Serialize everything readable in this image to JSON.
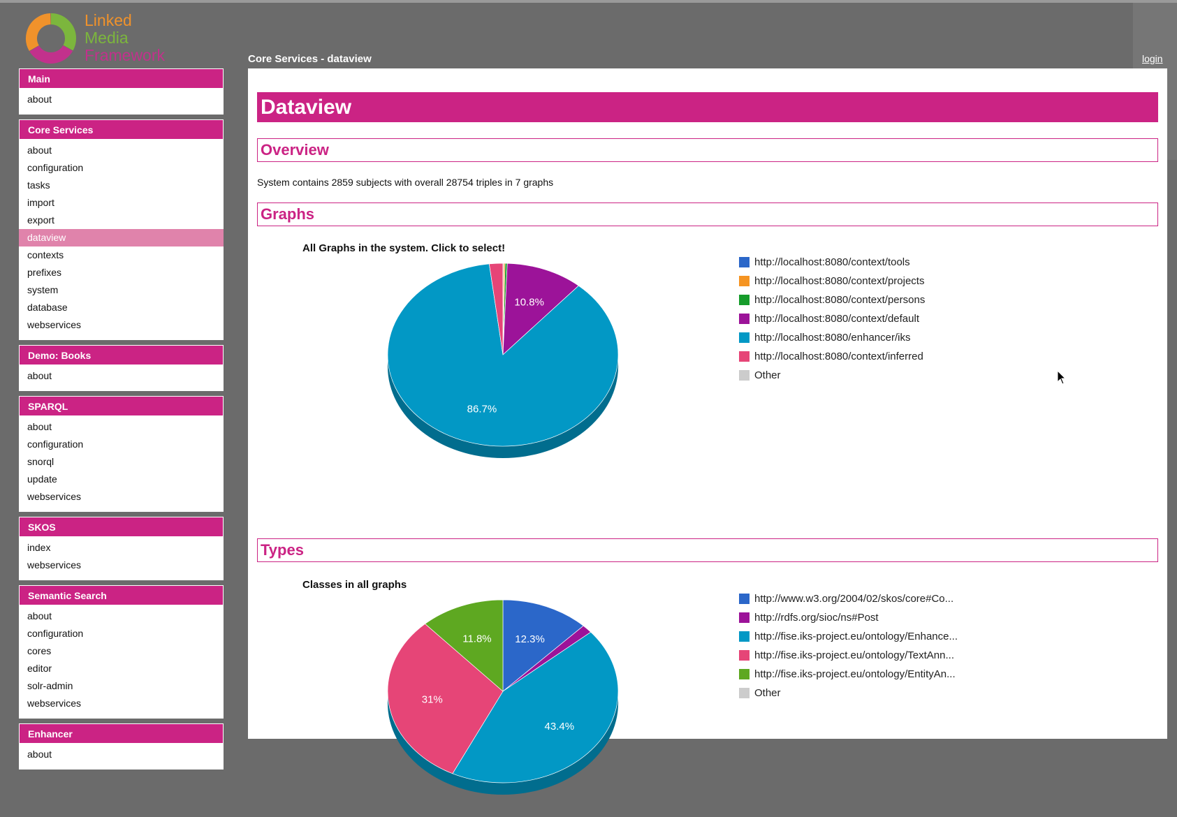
{
  "logo": {
    "line1": "Linked",
    "line2": "Media",
    "line3": "Framework"
  },
  "header": {
    "breadcrumb": "Core Services - dataview",
    "login": "login"
  },
  "sidebar": {
    "sections": [
      {
        "title": "Main",
        "items": [
          "about"
        ]
      },
      {
        "title": "Core Services",
        "items": [
          "about",
          "configuration",
          "tasks",
          "import",
          "export",
          "dataview",
          "contexts",
          "prefixes",
          "system",
          "database",
          "webservices"
        ],
        "active": "dataview"
      },
      {
        "title": "Demo: Books",
        "items": [
          "about"
        ]
      },
      {
        "title": "SPARQL",
        "items": [
          "about",
          "configuration",
          "snorql",
          "update",
          "webservices"
        ]
      },
      {
        "title": "SKOS",
        "items": [
          "index",
          "webservices"
        ]
      },
      {
        "title": "Semantic Search",
        "items": [
          "about",
          "configuration",
          "cores",
          "editor",
          "solr-admin",
          "webservices"
        ]
      },
      {
        "title": "Enhancer",
        "items": [
          "about"
        ]
      }
    ]
  },
  "main": {
    "title": "Dataview",
    "overview": {
      "heading": "Overview",
      "text": "System contains 2859 subjects with overall 28754 triples in 7 graphs"
    },
    "graphs_heading": "Graphs",
    "types_heading": "Types"
  },
  "chart_data": [
    {
      "type": "pie",
      "title": "All Graphs in the system. Click to select!",
      "labels": [
        "http://localhost:8080/context/tools",
        "http://localhost:8080/context/projects",
        "http://localhost:8080/context/persons",
        "http://localhost:8080/context/default",
        "http://localhost:8080/enhancer/iks",
        "http://localhost:8080/context/inferred",
        "Other"
      ],
      "values": [
        0.1,
        0.2,
        0.3,
        10.8,
        86.7,
        1.9,
        0
      ],
      "slice_labels": [
        "",
        "",
        "",
        "10.8%",
        "86.7%",
        "",
        ""
      ],
      "colors": [
        "#2b67c9",
        "#f59422",
        "#169c2b",
        "#9c1399",
        "#0298c5",
        "#e64577",
        "#cccccc"
      ],
      "legend": "right"
    },
    {
      "type": "pie",
      "title": "Classes in all graphs",
      "labels": [
        "http://www.w3.org/2004/02/skos/core#Co...",
        "http://rdfs.org/sioc/ns#Post",
        "http://fise.iks-project.eu/ontology/Enhance...",
        "http://fise.iks-project.eu/ontology/TextAnn...",
        "http://fise.iks-project.eu/ontology/EntityAn...",
        "Other"
      ],
      "values": [
        12.3,
        1.5,
        43.4,
        31,
        11.8,
        0
      ],
      "slice_labels": [
        "12.3%",
        "",
        "43.4%",
        "31%",
        "11.8%",
        ""
      ],
      "colors": [
        "#2b67c9",
        "#9c1399",
        "#0298c5",
        "#e64577",
        "#5ea821",
        "#cccccc"
      ],
      "legend": "right"
    }
  ]
}
